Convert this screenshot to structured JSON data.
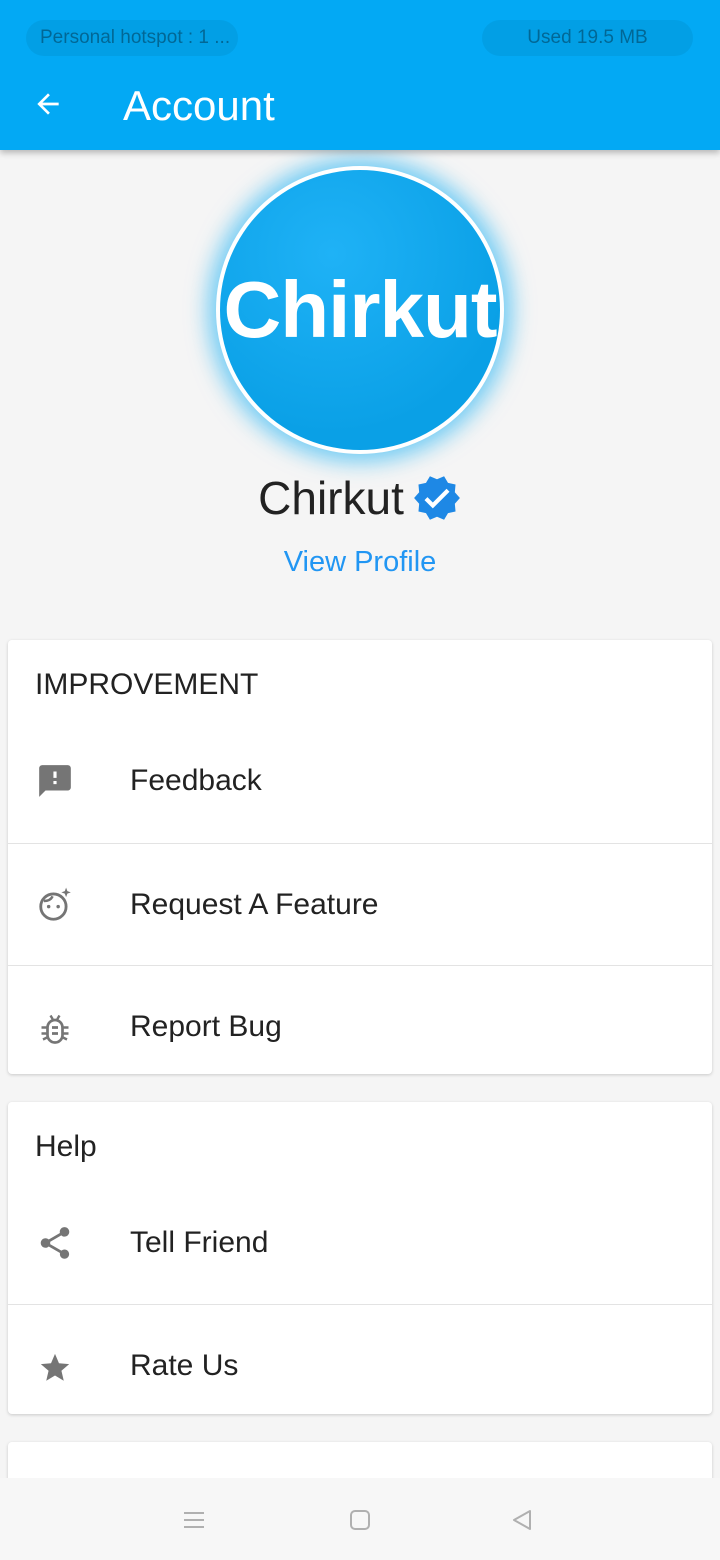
{
  "status_bar": {
    "left_text": "Personal hotspot : 1 ...",
    "right_text": "Used  19.5 MB"
  },
  "app_bar": {
    "back_icon": "arrow-back-icon",
    "title": "Account"
  },
  "profile": {
    "avatar_text": "Chirkut",
    "name": "Chirkut",
    "verified_icon": "verified-badge-icon",
    "view_profile_label": "View Profile"
  },
  "sections": {
    "improvement": {
      "title": "IMPROVEMENT",
      "items": [
        {
          "label": "Feedback",
          "icon": "feedback-icon"
        },
        {
          "label": "Request A Feature",
          "icon": "face-sparkle-icon"
        },
        {
          "label": "Report Bug",
          "icon": "bug-icon"
        }
      ]
    },
    "help": {
      "title": "Help",
      "items": [
        {
          "label": "Tell Friend",
          "icon": "share-icon"
        },
        {
          "label": "Rate Us",
          "icon": "star-icon"
        }
      ]
    }
  },
  "nav_bar": {
    "menu_icon": "menu-icon",
    "home_icon": "home-square-icon",
    "back_icon": "back-triangle-icon"
  },
  "colors": {
    "accent": "#03a9f4",
    "link": "#2196f3",
    "verified": "#1e88e5",
    "icon_gray": "#757575"
  }
}
